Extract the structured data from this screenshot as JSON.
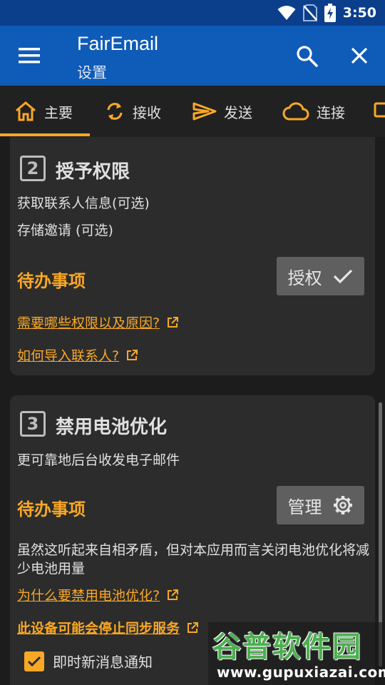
{
  "status_bar": {
    "time": "3:50",
    "icons": [
      "wifi-icon",
      "no-sim-icon",
      "battery-charging-icon"
    ]
  },
  "app_bar": {
    "title": "FairEmail",
    "subtitle": "设置",
    "icons": [
      "menu-icon",
      "search-icon",
      "close-icon"
    ]
  },
  "tabs": [
    {
      "label": "主要",
      "icon": "home-icon",
      "selected": true
    },
    {
      "label": "接收",
      "icon": "sync-icon"
    },
    {
      "label": "发送",
      "icon": "send-icon"
    },
    {
      "label": "连接",
      "icon": "cloud-icon"
    }
  ],
  "cards": [
    {
      "step": "2",
      "title": "授予权限",
      "descriptions": [
        "获取联系人信息(可选)",
        "存储邀请 (可选)"
      ],
      "todo_label": "待办事项",
      "button_label": "授权",
      "button_icon": "check-icon",
      "links": [
        "需要哪些权限以及原因?",
        "如何导入联系人?"
      ]
    },
    {
      "step": "3",
      "title": "禁用电池优化",
      "description": "更可靠地后台收发电子邮件",
      "todo_label": "待办事项",
      "button_label": "管理",
      "button_icon": "gear-icon",
      "note": "虽然这听起来自相矛盾，但对本应用而言关闭电池优化将减少电池用量",
      "links": [
        "为什么要禁用电池优化?",
        "此设备可能会停止同步服务"
      ],
      "checkbox_label": "即时新消息通知",
      "checkbox_checked": true
    }
  ],
  "watermark": {
    "logo_text": "谷普软件园",
    "url": "www.gupuxiazai.com"
  },
  "colors": {
    "status_bar": "#0b3f8c",
    "app_bar": "#0f5bb8",
    "accent": "#f9a825",
    "card": "#2c2c2c",
    "background": "#1c1c1c"
  }
}
